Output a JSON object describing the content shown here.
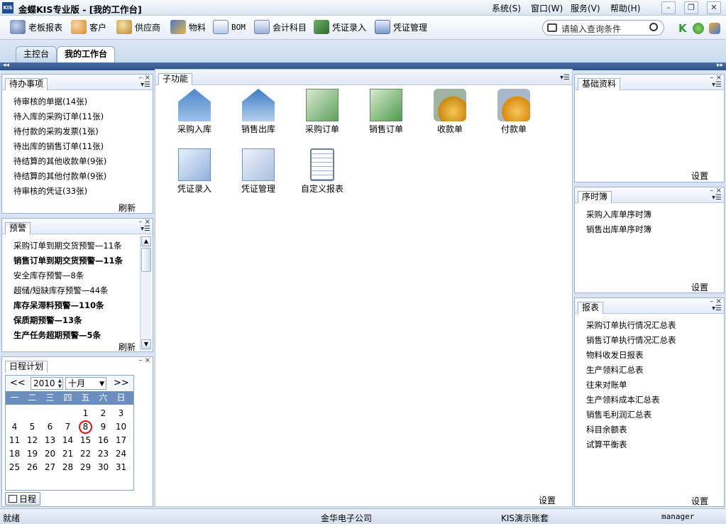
{
  "window": {
    "app_badge": "KIS",
    "title": "金蝶KIS专业版 - [我的工作台]"
  },
  "menu": [
    "系统(S)",
    "窗口(W)",
    "服务(V)",
    "帮助(H)"
  ],
  "window_controls": {
    "minimize": "–",
    "restore": "❐",
    "close": "✕"
  },
  "toolbar": {
    "items": [
      "老板报表",
      "客户",
      "供应商",
      "物料",
      "BOM",
      "会计科目",
      "凭证录入",
      "凭证管理"
    ],
    "search_placeholder": "请输入查询条件"
  },
  "tabs": [
    "主控台",
    "我的工作台"
  ],
  "nav": {
    "left": "◂◂",
    "right": "▸▸"
  },
  "todo": {
    "title": "待办事项",
    "items": [
      "待审核的单据(14张)",
      "待入库的采购订单(11张)",
      "待付款的采购发票(1张)",
      "待出库的销售订单(11张)",
      "待结算的其他收款单(9张)",
      "待结算的其他付款单(9张)",
      "待审核的凭证(33张)"
    ],
    "refresh": "刷新"
  },
  "alert": {
    "title": "预警",
    "items": [
      {
        "text": "采购订单到期交货预警—11条",
        "bold": false
      },
      {
        "text": "销售订单到期交货预警—11条",
        "bold": true
      },
      {
        "text": "安全库存预警—8条",
        "bold": false
      },
      {
        "text": "超储/短缺库存预警—44条",
        "bold": false
      },
      {
        "text": "库存呆滞料预警—110条",
        "bold": true
      },
      {
        "text": "保质期预警—13条",
        "bold": true
      },
      {
        "text": "生产任务超期预警—5条",
        "bold": true
      }
    ],
    "refresh": "刷新"
  },
  "calendar": {
    "title": "日程计划",
    "prev": "<<",
    "next": ">>",
    "year": "2010",
    "month": "十月",
    "weekdays": [
      "一",
      "二",
      "三",
      "四",
      "五",
      "六",
      "日"
    ],
    "weeks": [
      [
        "",
        "",
        "",
        "",
        "1",
        "2",
        "3"
      ],
      [
        "4",
        "5",
        "6",
        "7",
        "8",
        "9",
        "10"
      ],
      [
        "11",
        "12",
        "13",
        "14",
        "15",
        "16",
        "17"
      ],
      [
        "18",
        "19",
        "20",
        "21",
        "22",
        "23",
        "24"
      ],
      [
        "25",
        "26",
        "27",
        "28",
        "29",
        "30",
        "31"
      ]
    ],
    "today": "8",
    "schedule_button": "日程"
  },
  "functions": {
    "title": "子功能",
    "items": [
      "采购入库",
      "销售出库",
      "采购订单",
      "销售订单",
      "收款单",
      "付款单",
      "凭证录入",
      "凭证管理",
      "自定义报表"
    ],
    "settings": "设置"
  },
  "basic": {
    "title": "基础资料",
    "settings": "设置"
  },
  "journal": {
    "title": "序时簿",
    "items": [
      "采购入库单序时簿",
      "销售出库单序时簿"
    ],
    "settings": "设置"
  },
  "reports": {
    "title": "报表",
    "items": [
      "采购订单执行情况汇总表",
      "销售订单执行情况汇总表",
      "物料收发日报表",
      "生产领料汇总表",
      "往来对账单",
      "生产领料成本汇总表",
      "销售毛利润汇总表",
      "科目余额表",
      "试算平衡表"
    ],
    "settings": "设置"
  },
  "panel_controls": {
    "min": "–",
    "close": "×",
    "menu": "▾☰"
  },
  "status": {
    "ready": "就绪",
    "company": "金华电子公司",
    "account": "KIS演示账套",
    "user": "manager"
  },
  "colors": {
    "accent": "#1f4c9a",
    "link_blue": "#0b3d91",
    "calendar_header": "#6c8ebf",
    "today_ring": "#d11"
  }
}
